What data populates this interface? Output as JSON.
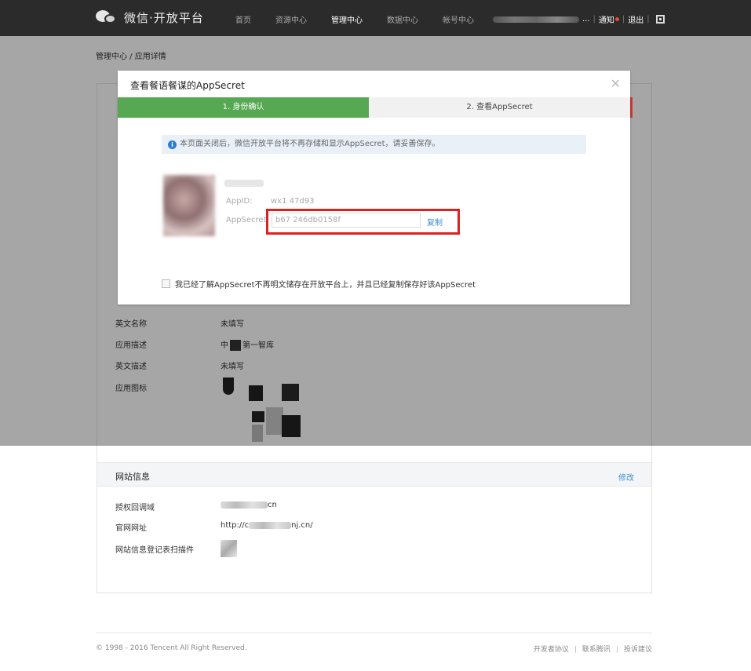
{
  "header": {
    "brand": "微信·开放平台",
    "nav": [
      "首页",
      "资源中心",
      "管理中心",
      "数据中心",
      "帐号中心"
    ],
    "active_nav": "管理中心",
    "user_suffix": "...",
    "notify": "通知",
    "logout": "退出"
  },
  "breadcrumb": "管理中心 / 应用详情",
  "modal": {
    "title": "查看餐语餐谋的AppSecret",
    "step1": "1. 身份确认",
    "step2": "2. 查看AppSecret",
    "notice": "本页面关闭后，微信开放平台将不再存储和显示AppSecret，请妥善保存。",
    "appid_label": "AppID:",
    "appid_value": "wx1       47d93",
    "secret_label": "AppSecret",
    "secret_value": "b67                 246db0158f",
    "copy": "复制",
    "agree": "我已经了解AppSecret不再明文储存在开放平台上，并且已经复制保存好该AppSecret"
  },
  "basic": {
    "rows": [
      {
        "label": "英文名称",
        "value": "未填写"
      },
      {
        "label": "应用描述",
        "value_pre": "中",
        "value_post": "第一智库"
      },
      {
        "label": "英文描述",
        "value": "未填写"
      },
      {
        "label": "应用图标",
        "value": ""
      }
    ]
  },
  "website": {
    "title": "网站信息",
    "edit": "修改",
    "rows": [
      {
        "label": "授权回调域",
        "value": "cn"
      },
      {
        "label": "官网网址",
        "value_pre": "http://c",
        "value_post": "nj.cn/"
      },
      {
        "label": "网站信息登记表扫描件",
        "value": ""
      }
    ]
  },
  "footer": {
    "copyright": "© 1998 - 2016 Tencent All Right Reserved.",
    "links": [
      "开发者协议",
      "联系腾讯",
      "投诉建议"
    ]
  }
}
